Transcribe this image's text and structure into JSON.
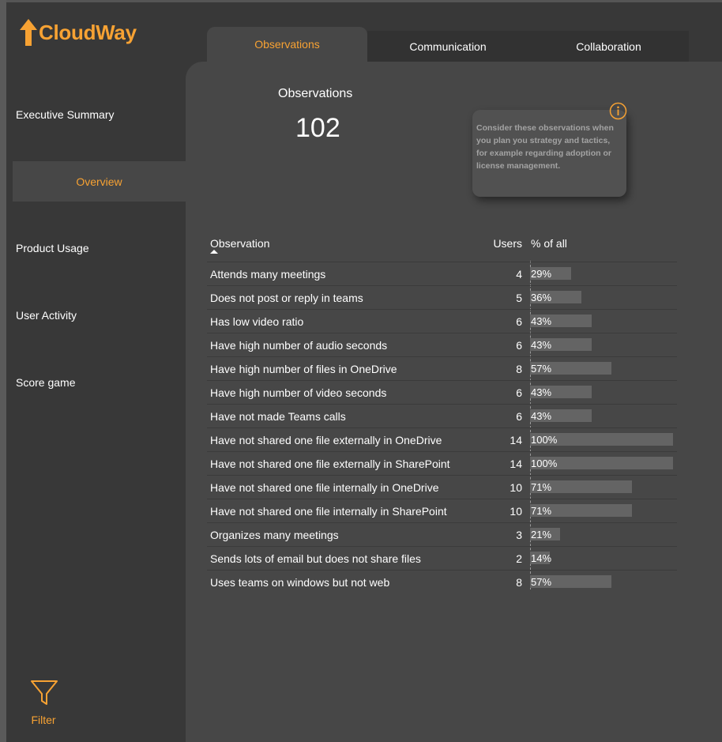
{
  "app": {
    "logo_text": "CloudWay",
    "brand_color": "#f7a233"
  },
  "sidebar": {
    "items": [
      {
        "label": "Executive Summary",
        "active": false
      },
      {
        "label": "Overview",
        "active": true
      },
      {
        "label": "Product Usage",
        "active": false
      },
      {
        "label": "User Activity",
        "active": false
      },
      {
        "label": "Score game",
        "active": false
      }
    ],
    "filter_label": "Filter",
    "filter_icon": "funnel-icon"
  },
  "tabs": [
    {
      "label": "Observations",
      "active": true
    },
    {
      "label": "Communication",
      "active": false
    },
    {
      "label": "Collaboration",
      "active": false
    }
  ],
  "kpi": {
    "title": "Observations",
    "value": "102"
  },
  "info_card": {
    "icon": "info-icon",
    "text": "Consider these observations when you plan you strategy and tactics, for example regarding adoption or license management."
  },
  "table": {
    "headers": {
      "observation": "Observation",
      "users": "Users",
      "percent": "% of all"
    },
    "sort": {
      "column": "observation",
      "direction": "ascending"
    },
    "rows": [
      {
        "observation": "Attends many meetings",
        "users": "4",
        "percent": "29%",
        "pct_value": 29
      },
      {
        "observation": "Does not post or reply in teams",
        "users": "5",
        "percent": "36%",
        "pct_value": 36
      },
      {
        "observation": "Has low video ratio",
        "users": "6",
        "percent": "43%",
        "pct_value": 43
      },
      {
        "observation": "Have high number of audio seconds",
        "users": "6",
        "percent": "43%",
        "pct_value": 43
      },
      {
        "observation": "Have high number of files in OneDrive",
        "users": "8",
        "percent": "57%",
        "pct_value": 57
      },
      {
        "observation": "Have high number of video seconds",
        "users": "6",
        "percent": "43%",
        "pct_value": 43
      },
      {
        "observation": "Have not made Teams calls",
        "users": "6",
        "percent": "43%",
        "pct_value": 43
      },
      {
        "observation": "Have not shared one file externally in OneDrive",
        "users": "14",
        "percent": "100%",
        "pct_value": 100
      },
      {
        "observation": "Have not shared one file externally in SharePoint",
        "users": "14",
        "percent": "100%",
        "pct_value": 100
      },
      {
        "observation": "Have not shared one file internally in OneDrive",
        "users": "10",
        "percent": "71%",
        "pct_value": 71
      },
      {
        "observation": "Have not shared one file internally in SharePoint",
        "users": "10",
        "percent": "71%",
        "pct_value": 71
      },
      {
        "observation": "Organizes many meetings",
        "users": "3",
        "percent": "21%",
        "pct_value": 21
      },
      {
        "observation": "Sends lots of email but does not share files",
        "users": "2",
        "percent": "14%",
        "pct_value": 14
      },
      {
        "observation": "Uses teams on windows but not web",
        "users": "8",
        "percent": "57%",
        "pct_value": 57
      }
    ]
  }
}
